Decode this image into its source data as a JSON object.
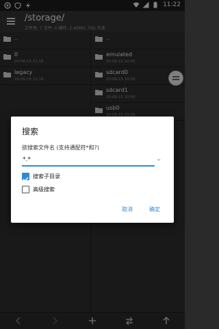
{
  "statusbar": {
    "time": "11:22"
  },
  "appbar": {
    "path": "/storage/",
    "info": "文件夹: 7  文件: 0  储存: 2.42M/1.70G  只读"
  },
  "left_pane": {
    "up_label": "..",
    "items": [
      {
        "name": "0",
        "date": "20-06-15 11:16"
      },
      {
        "name": "legacy",
        "date": "20-06-15 11:16"
      }
    ]
  },
  "right_pane": {
    "up_label": "..",
    "items": [
      {
        "name": "emulated",
        "date": "20-06-15 10:50"
      },
      {
        "name": "sdcard0",
        "date": "20-06-15 10:50"
      },
      {
        "name": "sdcard1",
        "date": "20-06-15 10:50"
      },
      {
        "name": "usb0",
        "date": "20-06-15 10:50"
      }
    ]
  },
  "dialog": {
    "title": "搜索",
    "label": "欲搜索文件名 (支持通配符*和?)",
    "input_value": "*.*",
    "subdir_label": "搜索子目录",
    "subdir_checked": true,
    "advanced_label": "高级搜索",
    "advanced_checked": false,
    "cancel": "取消",
    "ok": "确定"
  },
  "colors": {
    "accent": "#2e8bd9",
    "background": "#2e2e2e",
    "dialog": "#ffffff"
  },
  "icons": [
    "menu-icon",
    "folder-icon",
    "back-arrow-icon",
    "forward-arrow-icon",
    "add-icon",
    "swap-icon",
    "up-arrow-icon"
  ]
}
